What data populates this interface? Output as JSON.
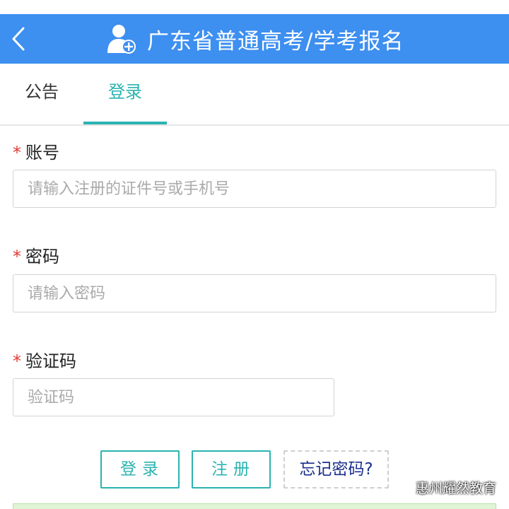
{
  "header": {
    "title": "广东省普通高考/学考报名",
    "color": "#3d8ff0"
  },
  "tabs": [
    {
      "label": "公告"
    },
    {
      "label": "登录",
      "active": true
    }
  ],
  "form": {
    "account": {
      "label": "账号",
      "placeholder": "请输入注册的证件号或手机号"
    },
    "password": {
      "label": "密码",
      "placeholder": "请输入密码"
    },
    "captcha": {
      "label": "验证码",
      "placeholder": "验证码"
    },
    "required_mark": "*"
  },
  "buttons": {
    "login": "登录",
    "register": "注册",
    "forgot": "忘记密码?"
  },
  "watermark": {
    "text": "惠州耀然教育"
  },
  "colors": {
    "accent": "#2bb3b0",
    "required": "#e53935",
    "link": "#1a2f8c"
  }
}
